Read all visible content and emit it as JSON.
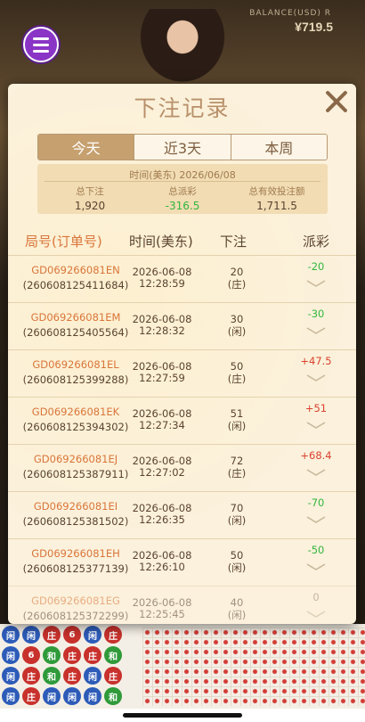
{
  "background": {
    "balance_label": "BALANCE(USD) R",
    "balance_value": "¥719.5",
    "board_beads": [
      {
        "text": "闲",
        "color": "blue"
      },
      {
        "text": "闲",
        "color": "blue"
      },
      {
        "text": "庄",
        "color": "red"
      },
      {
        "text": "6",
        "color": "red"
      },
      {
        "text": "闲",
        "color": "blue"
      },
      {
        "text": "庄",
        "color": "red"
      },
      {
        "text": "闲",
        "color": "blue"
      },
      {
        "text": "6",
        "color": "red"
      },
      {
        "text": "和",
        "color": "green"
      },
      {
        "text": "庄",
        "color": "red"
      },
      {
        "text": "庄",
        "color": "red"
      },
      {
        "text": "和",
        "color": "green"
      },
      {
        "text": "闲",
        "color": "blue"
      },
      {
        "text": "庄",
        "color": "red"
      },
      {
        "text": "和",
        "color": "green"
      },
      {
        "text": "庄",
        "color": "red"
      },
      {
        "text": "闲",
        "color": "blue"
      },
      {
        "text": "庄",
        "color": "red"
      },
      {
        "text": "闲",
        "color": "blue"
      },
      {
        "text": "庄",
        "color": "red"
      },
      {
        "text": "闲",
        "color": "blue"
      },
      {
        "text": "闲",
        "color": "blue"
      },
      {
        "text": "闲",
        "color": "blue"
      },
      {
        "text": "和",
        "color": "green"
      }
    ]
  },
  "modal": {
    "title": "下注记录",
    "tabs": [
      {
        "label": "今天",
        "active": true
      },
      {
        "label": "近3天",
        "active": false
      },
      {
        "label": "本周",
        "active": false
      }
    ],
    "summary": {
      "date": "时间(美东) 2026/06/08",
      "total_bet_label": "总下注",
      "total_bet": "1,920",
      "total_payout_label": "总派彩",
      "total_payout": "-316.5",
      "valid_bet_label": "总有效投注额",
      "valid_bet": "1,711.5"
    },
    "columns": {
      "id": "局号(订单号)",
      "time": "时间(美东)",
      "bet": "下注",
      "payout": "派彩"
    },
    "rows": [
      {
        "order_id": "GD069266081EN",
        "number": "(260608125411684)",
        "date": "2026-06-08",
        "time": "12:28:59",
        "amount": "20",
        "side": "(庄)",
        "payout": "-20",
        "color": "green"
      },
      {
        "order_id": "GD069266081EM",
        "number": "(260608125405564)",
        "date": "2026-06-08",
        "time": "12:28:32",
        "amount": "30",
        "side": "(闲)",
        "payout": "-30",
        "color": "green"
      },
      {
        "order_id": "GD069266081EL",
        "number": "(260608125399288)",
        "date": "2026-06-08",
        "time": "12:27:59",
        "amount": "50",
        "side": "(庄)",
        "payout": "+47.5",
        "color": "red"
      },
      {
        "order_id": "GD069266081EK",
        "number": "(260608125394302)",
        "date": "2026-06-08",
        "time": "12:27:34",
        "amount": "51",
        "side": "(闲)",
        "payout": "+51",
        "color": "red"
      },
      {
        "order_id": "GD069266081EJ",
        "number": "(260608125387911)",
        "date": "2026-06-08",
        "time": "12:27:02",
        "amount": "72",
        "side": "(庄)",
        "payout": "+68.4",
        "color": "red"
      },
      {
        "order_id": "GD069266081EI",
        "number": "(260608125381502)",
        "date": "2026-06-08",
        "time": "12:26:35",
        "amount": "70",
        "side": "(闲)",
        "payout": "-70",
        "color": "green"
      },
      {
        "order_id": "GD069266081EH",
        "number": "(260608125377139)",
        "date": "2026-06-08",
        "time": "12:26:10",
        "amount": "50",
        "side": "(闲)",
        "payout": "-50",
        "color": "green"
      },
      {
        "order_id": "GD069266081EG",
        "number": "(260608125372299)",
        "date": "2026-06-08",
        "time": "12:25:45",
        "amount": "40",
        "side": "(闲)",
        "payout": "0",
        "color": "gray"
      }
    ]
  }
}
